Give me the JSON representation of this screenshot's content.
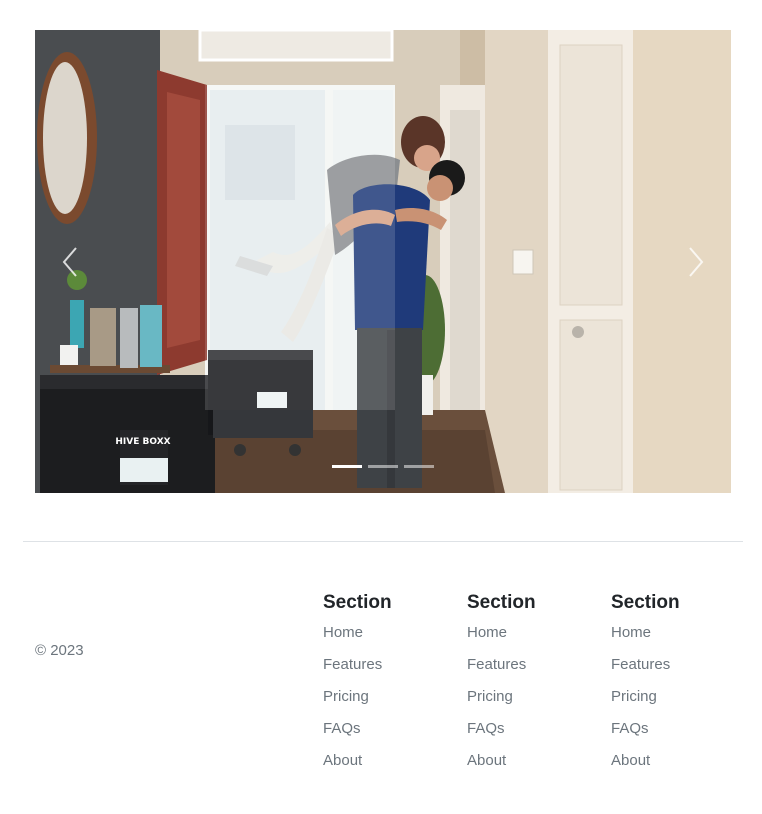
{
  "carousel": {
    "image_alt": "Couple embracing in the hallway of a new home among moving crates",
    "crate_label": "HIVE BOXX",
    "prev_label": "Previous",
    "next_label": "Next",
    "slides": 3,
    "active_slide": 1
  },
  "footer": {
    "copyright": "© 2023",
    "sections": [
      {
        "title": "Section",
        "links": [
          "Home",
          "Features",
          "Pricing",
          "FAQs",
          "About"
        ]
      },
      {
        "title": "Section",
        "links": [
          "Home",
          "Features",
          "Pricing",
          "FAQs",
          "About"
        ]
      },
      {
        "title": "Section",
        "links": [
          "Home",
          "Features",
          "Pricing",
          "FAQs",
          "About"
        ]
      }
    ]
  }
}
